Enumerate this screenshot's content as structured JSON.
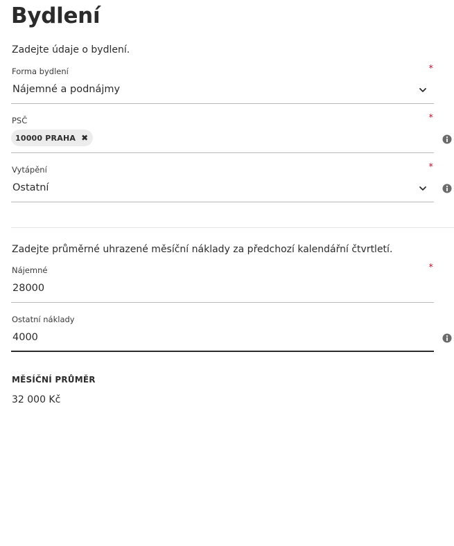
{
  "page": {
    "title": "Bydlení",
    "intro_housing": "Zadejte údaje o bydlení.",
    "intro_costs": "Zadejte průměrné uhrazené měsíční náklady za předchozí kalendářní čtvrtletí."
  },
  "fields": {
    "forma_bydleni": {
      "label": "Forma bydlení",
      "value": "Nájemné a podnájmy",
      "required_mark": "*",
      "icon": "chevron-down-icon"
    },
    "psc": {
      "label": "PSČ",
      "chip_value": "10000 PRAHA",
      "chip_remove": "✖",
      "required_mark": "*",
      "icon": "info-icon"
    },
    "vytapeni": {
      "label": "Vytápění",
      "value": "Ostatní",
      "required_mark": "*",
      "icon": "chevron-down-icon"
    },
    "najemne": {
      "label": "Nájemné",
      "value": "28000",
      "required_mark": "*"
    },
    "ostatni_naklady": {
      "label": "Ostatní náklady",
      "value": "4000",
      "icon": "info-icon"
    }
  },
  "summary": {
    "label": "MĚSÍČNÍ PRŮMĚR",
    "value": "32 000 Kč"
  },
  "colors": {
    "required": "#c8102e",
    "text": "#2b2b2b",
    "underline": "#b8b8b8",
    "chip_bg": "#ececec",
    "icon": "#6b6b6b"
  }
}
